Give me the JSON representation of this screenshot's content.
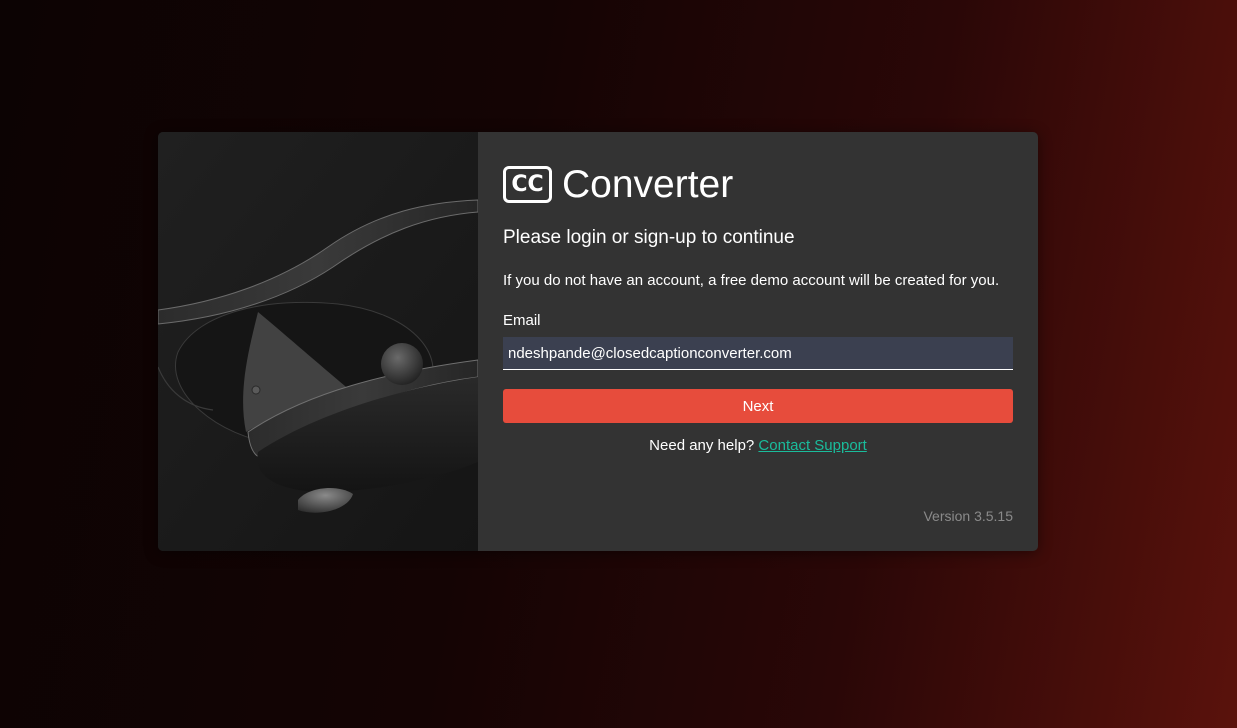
{
  "brand": {
    "logo_mark": "CC",
    "name": "Converter"
  },
  "login": {
    "heading": "Please login or sign-up to continue",
    "description": "If you do not have an account, a free demo account will be created for you.",
    "email_label": "Email",
    "email_value": "ndeshpande@closedcaptionconverter.com",
    "next_label": "Next",
    "help_prefix": "Need any help?",
    "help_link": "Contact Support"
  },
  "footer": {
    "version": "Version 3.5.15"
  },
  "colors": {
    "accent_button": "#e74c3c",
    "link": "#1abc9c",
    "panel_bg": "#333333",
    "input_bg": "#3b4050"
  }
}
